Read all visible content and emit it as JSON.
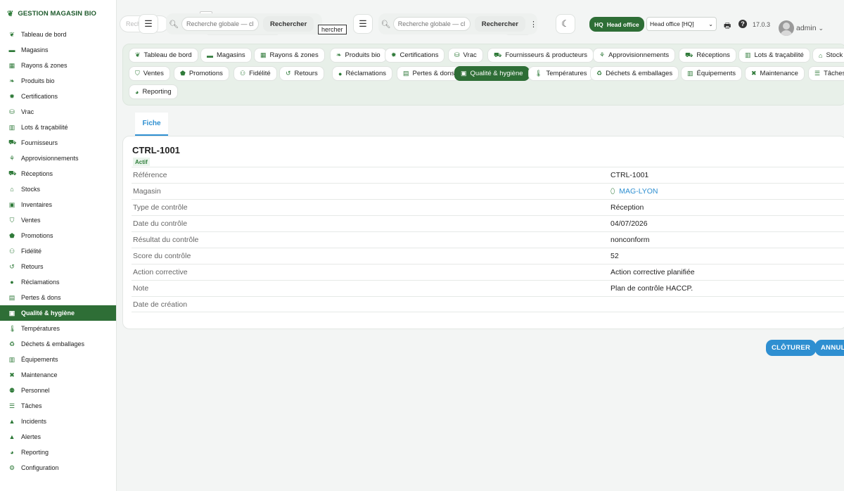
{
  "app": {
    "brand": "GESTION MAGASIN BIO"
  },
  "sidebar": {
    "items": [
      {
        "label": "Tableau de bord",
        "icon": "sprout-icon"
      },
      {
        "label": "Magasins",
        "icon": "store-icon"
      },
      {
        "label": "Rayons & zones",
        "icon": "grid-icon"
      },
      {
        "label": "Produits bio",
        "icon": "leaf-icon"
      },
      {
        "label": "Certifications",
        "icon": "certificate-icon"
      },
      {
        "label": "Vrac",
        "icon": "bulk-icon"
      },
      {
        "label": "Lots & traçabilité",
        "icon": "barcode-icon"
      },
      {
        "label": "Fournisseurs",
        "icon": "truck-icon"
      },
      {
        "label": "Approvisionnements",
        "icon": "seedling-icon"
      },
      {
        "label": "Réceptions",
        "icon": "dolly-icon"
      },
      {
        "label": "Stocks",
        "icon": "warehouse-icon"
      },
      {
        "label": "Inventaires",
        "icon": "clipboard-check-icon"
      },
      {
        "label": "Ventes",
        "icon": "basket-icon"
      },
      {
        "label": "Promotions",
        "icon": "tags-icon"
      },
      {
        "label": "Fidélité",
        "icon": "award-icon"
      },
      {
        "label": "Retours",
        "icon": "undo-icon"
      },
      {
        "label": "Réclamations",
        "icon": "comment-icon"
      },
      {
        "label": "Pertes & dons",
        "icon": "trash-icon"
      },
      {
        "label": "Qualité & hygiène",
        "icon": "clipboard-icon",
        "active": true
      },
      {
        "label": "Températures",
        "icon": "thermometer-icon"
      },
      {
        "label": "Déchets & emballages",
        "icon": "recycle-icon"
      },
      {
        "label": "Équipements",
        "icon": "blender-icon"
      },
      {
        "label": "Maintenance",
        "icon": "tools-icon"
      },
      {
        "label": "Personnel",
        "icon": "users-icon"
      },
      {
        "label": "Tâches",
        "icon": "list-icon"
      },
      {
        "label": "Incidents",
        "icon": "warning-icon"
      },
      {
        "label": "Alertes",
        "icon": "bell-icon"
      },
      {
        "label": "Reporting",
        "icon": "pie-chart-icon"
      },
      {
        "label": "Configuration",
        "icon": "cog-icon"
      }
    ]
  },
  "topbar": {
    "search_placeholder_1": "Recherche globale — cl",
    "search_placeholder_2": "Recherche globale — cl",
    "search_placeholder_ghost": "Rech",
    "search_button_1": "Rechercher",
    "search_button_2": "Rechercher",
    "tooltip": "hercher",
    "hq_badge_code": "HQ",
    "hq_badge_label": "Head office",
    "office_select_value": "Head office [HQ]",
    "version": "17.0.3",
    "user": "admin"
  },
  "modules": [
    {
      "label": "Tableau de bord",
      "icon": "sprout-icon"
    },
    {
      "label": "Magasins",
      "icon": "store-icon"
    },
    {
      "label": "Rayons & zones",
      "icon": "grid-icon"
    },
    {
      "label": "Produits bio",
      "icon": "leaf-icon"
    },
    {
      "label": "Certifications",
      "icon": "certificate-icon"
    },
    {
      "label": "Vrac",
      "icon": "bulk-icon"
    },
    {
      "label": "Fournisseurs & producteurs",
      "icon": "truck-icon"
    },
    {
      "label": "Approvisionnements",
      "icon": "seedling-icon"
    },
    {
      "label": "Réceptions",
      "icon": "dolly-icon"
    },
    {
      "label": "Lots & traçabilité",
      "icon": "barcode-icon"
    },
    {
      "label": "Stock",
      "icon": "warehouse-icon"
    },
    {
      "label": "Ventes",
      "icon": "basket-icon"
    },
    {
      "label": "Promotions",
      "icon": "tags-icon"
    },
    {
      "label": "Fidélité",
      "icon": "award-icon"
    },
    {
      "label": "Retours",
      "icon": "undo-icon"
    },
    {
      "label": "Réclamations",
      "icon": "comment-icon"
    },
    {
      "label": "Pertes & dons",
      "icon": "trash-icon"
    },
    {
      "label": "Qualité & hygiène",
      "icon": "clipboard-icon",
      "active": true
    },
    {
      "label": "Températures",
      "icon": "thermometer-icon"
    },
    {
      "label": "Déchets & emballages",
      "icon": "recycle-icon"
    },
    {
      "label": "Équipements",
      "icon": "blender-icon"
    },
    {
      "label": "Maintenance",
      "icon": "tools-icon"
    },
    {
      "label": "Tâches",
      "icon": "list-icon"
    },
    {
      "label": "Reporting",
      "icon": "pie-chart-icon"
    }
  ],
  "record": {
    "tab": "Fiche",
    "title": "CTRL-1001",
    "status": "Actif",
    "fields": [
      {
        "key": "Référence",
        "value": "CTRL-1001"
      },
      {
        "key": "Magasin",
        "value": "MAG-LYON",
        "link": true
      },
      {
        "key": "Type de contrôle",
        "value": "Réception"
      },
      {
        "key": "Date du contrôle",
        "value": "04/07/2026"
      },
      {
        "key": "Résultat du contrôle",
        "value": "nonconform"
      },
      {
        "key": "Score du contrôle",
        "value": "52"
      },
      {
        "key": "Action corrective",
        "value": "Action corrective planifiée"
      },
      {
        "key": "Note",
        "value": "Plan de contrôle HACCP."
      },
      {
        "key": "Date de création",
        "value": ""
      }
    ]
  },
  "actions": {
    "close": "CLÔTURER",
    "cancel": "ANNULE"
  },
  "colors": {
    "brand_green": "#2e6e36",
    "accent_blue": "#2e8fd1"
  }
}
